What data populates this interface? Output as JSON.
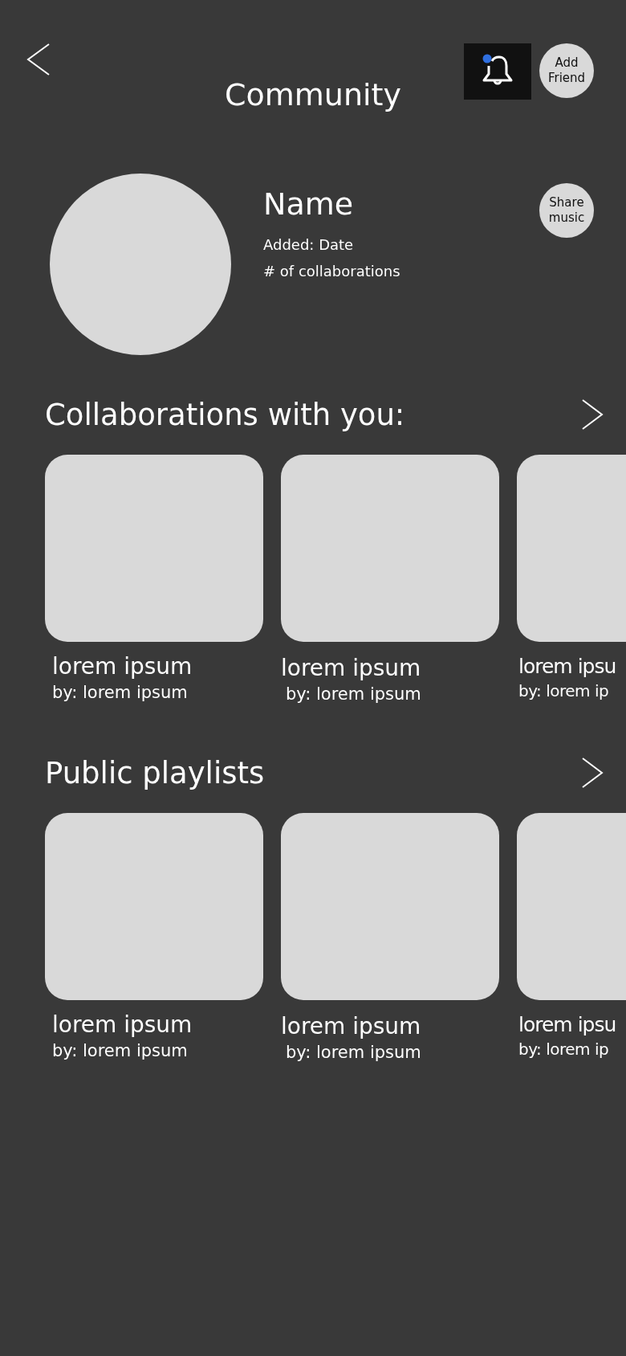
{
  "header": {
    "title": "Community",
    "notification_unread": true,
    "add_friend_label": "Add\nFriend"
  },
  "profile": {
    "name": "Name",
    "added": "Added: Date",
    "collaborations": "# of collaborations",
    "share_label": "Share\nmusic"
  },
  "sections": [
    {
      "title": "Collaborations with you:",
      "items": [
        {
          "title": "lorem ipsum",
          "by": "by: lorem ipsum"
        },
        {
          "title": "lorem ipsum",
          "by": "by: lorem ipsum"
        },
        {
          "title": "lorem ipsu",
          "by": "by: lorem ip"
        }
      ]
    },
    {
      "title": "Public playlists",
      "items": [
        {
          "title": "lorem ipsum",
          "by": "by: lorem ipsum"
        },
        {
          "title": "lorem ipsum",
          "by": "by: lorem ipsum"
        },
        {
          "title": "lorem ipsu",
          "by": "by: lorem ip"
        }
      ]
    }
  ]
}
